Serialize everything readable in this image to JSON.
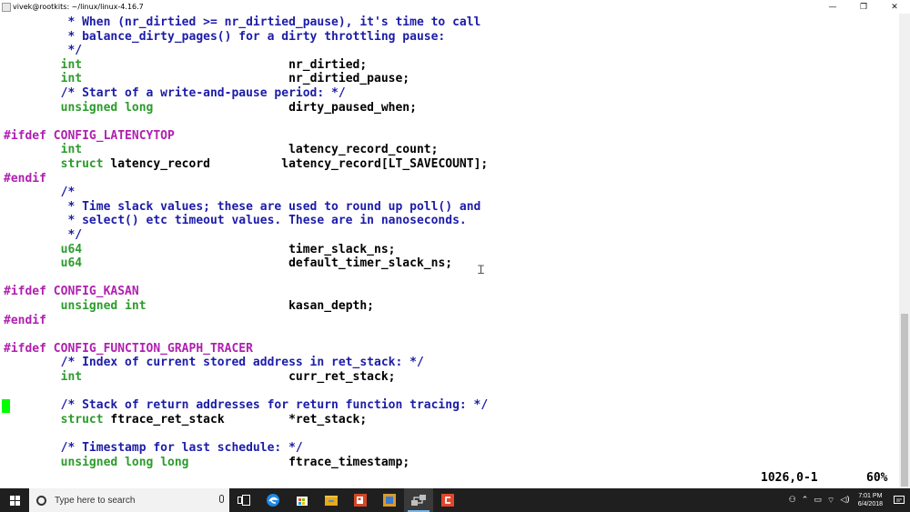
{
  "window": {
    "title": "vivek@rootkits: ~/linux/linux-4.16.7",
    "minimize_glyph": "—",
    "maximize_glyph": "❐",
    "close_glyph": "✕"
  },
  "colors": {
    "comment": "#1c1ca8",
    "type": "#2c9c2c",
    "preprocessor": "#b020b0",
    "normal": "#000000",
    "cursor": "#00ff00",
    "taskbar": "#1f1f1f"
  },
  "code_lines": [
    [
      {
        "t": "         * When (nr_dirtied >= nr_dirtied_pause), it's time to call",
        "c": "comment"
      }
    ],
    [
      {
        "t": "         * balance_dirty_pages() for a dirty throttling pause:",
        "c": "comment"
      }
    ],
    [
      {
        "t": "         */",
        "c": "comment"
      }
    ],
    [
      {
        "t": "        ",
        "c": "normal"
      },
      {
        "t": "int",
        "c": "type"
      },
      {
        "t": "                             nr_dirtied;",
        "c": "normal"
      }
    ],
    [
      {
        "t": "        ",
        "c": "normal"
      },
      {
        "t": "int",
        "c": "type"
      },
      {
        "t": "                             nr_dirtied_pause;",
        "c": "normal"
      }
    ],
    [
      {
        "t": "        /* Start of a write-and-pause period: */",
        "c": "comment"
      }
    ],
    [
      {
        "t": "        ",
        "c": "normal"
      },
      {
        "t": "unsigned long",
        "c": "type"
      },
      {
        "t": "                   dirty_paused_when;",
        "c": "normal"
      }
    ],
    [
      {
        "t": "",
        "c": "normal"
      }
    ],
    [
      {
        "t": "#ifdef CONFIG_LATENCYTOP",
        "c": "pre"
      }
    ],
    [
      {
        "t": "        ",
        "c": "normal"
      },
      {
        "t": "int",
        "c": "type"
      },
      {
        "t": "                             latency_record_count;",
        "c": "normal"
      }
    ],
    [
      {
        "t": "        ",
        "c": "normal"
      },
      {
        "t": "struct",
        "c": "type"
      },
      {
        "t": " latency_record          latency_record[LT_SAVECOUNT];",
        "c": "normal"
      }
    ],
    [
      {
        "t": "#endif",
        "c": "pre"
      }
    ],
    [
      {
        "t": "        /*",
        "c": "comment"
      }
    ],
    [
      {
        "t": "         * Time slack values; these are used to round up poll() and",
        "c": "comment"
      }
    ],
    [
      {
        "t": "         * select() etc timeout values. These are in nanoseconds.",
        "c": "comment"
      }
    ],
    [
      {
        "t": "         */",
        "c": "comment"
      }
    ],
    [
      {
        "t": "        ",
        "c": "normal"
      },
      {
        "t": "u64",
        "c": "type"
      },
      {
        "t": "                             timer_slack_ns;",
        "c": "normal"
      }
    ],
    [
      {
        "t": "        ",
        "c": "normal"
      },
      {
        "t": "u64",
        "c": "type"
      },
      {
        "t": "                             default_timer_slack_ns;",
        "c": "normal"
      }
    ],
    [
      {
        "t": "",
        "c": "normal"
      }
    ],
    [
      {
        "t": "#ifdef CONFIG_KASAN",
        "c": "pre"
      }
    ],
    [
      {
        "t": "        ",
        "c": "normal"
      },
      {
        "t": "unsigned int",
        "c": "type"
      },
      {
        "t": "                    kasan_depth;",
        "c": "normal"
      }
    ],
    [
      {
        "t": "#endif",
        "c": "pre"
      }
    ],
    [
      {
        "t": "",
        "c": "normal"
      }
    ],
    [
      {
        "t": "#ifdef CONFIG_FUNCTION_GRAPH_TRACER",
        "c": "pre"
      }
    ],
    [
      {
        "t": "        /* Index of current stored address in ret_stack: */",
        "c": "comment"
      }
    ],
    [
      {
        "t": "        ",
        "c": "normal"
      },
      {
        "t": "int",
        "c": "type"
      },
      {
        "t": "                             curr_ret_stack;",
        "c": "normal"
      }
    ],
    [
      {
        "t": "",
        "c": "normal"
      }
    ],
    [
      {
        "t": "        /* Stack of return addresses for return function tracing: */",
        "c": "comment"
      }
    ],
    [
      {
        "t": "        ",
        "c": "normal"
      },
      {
        "t": "struct",
        "c": "type"
      },
      {
        "t": " ftrace_ret_stack         *ret_stack;",
        "c": "normal"
      }
    ],
    [
      {
        "t": "",
        "c": "normal"
      }
    ],
    [
      {
        "t": "        /* Timestamp for last schedule: */",
        "c": "comment"
      }
    ],
    [
      {
        "t": "        ",
        "c": "normal"
      },
      {
        "t": "unsigned long long",
        "c": "type"
      },
      {
        "t": "              ftrace_timestamp;",
        "c": "normal"
      }
    ]
  ],
  "status": {
    "position": "1026,0-1",
    "percent": "60%"
  },
  "taskbar": {
    "search_placeholder": "Type here to search",
    "apps": [
      {
        "icon": "task-view-icon",
        "active": false
      },
      {
        "icon": "edge-icon",
        "active": false
      },
      {
        "icon": "store-icon",
        "active": false
      },
      {
        "icon": "file-explorer-icon",
        "active": false
      },
      {
        "icon": "powerpoint-icon",
        "active": false
      },
      {
        "icon": "app-icon",
        "active": false
      },
      {
        "icon": "network-terminal-icon",
        "active": true
      },
      {
        "icon": "red-app-icon",
        "active": false
      }
    ],
    "time": "7:01 PM",
    "date": "6/4/2018"
  }
}
